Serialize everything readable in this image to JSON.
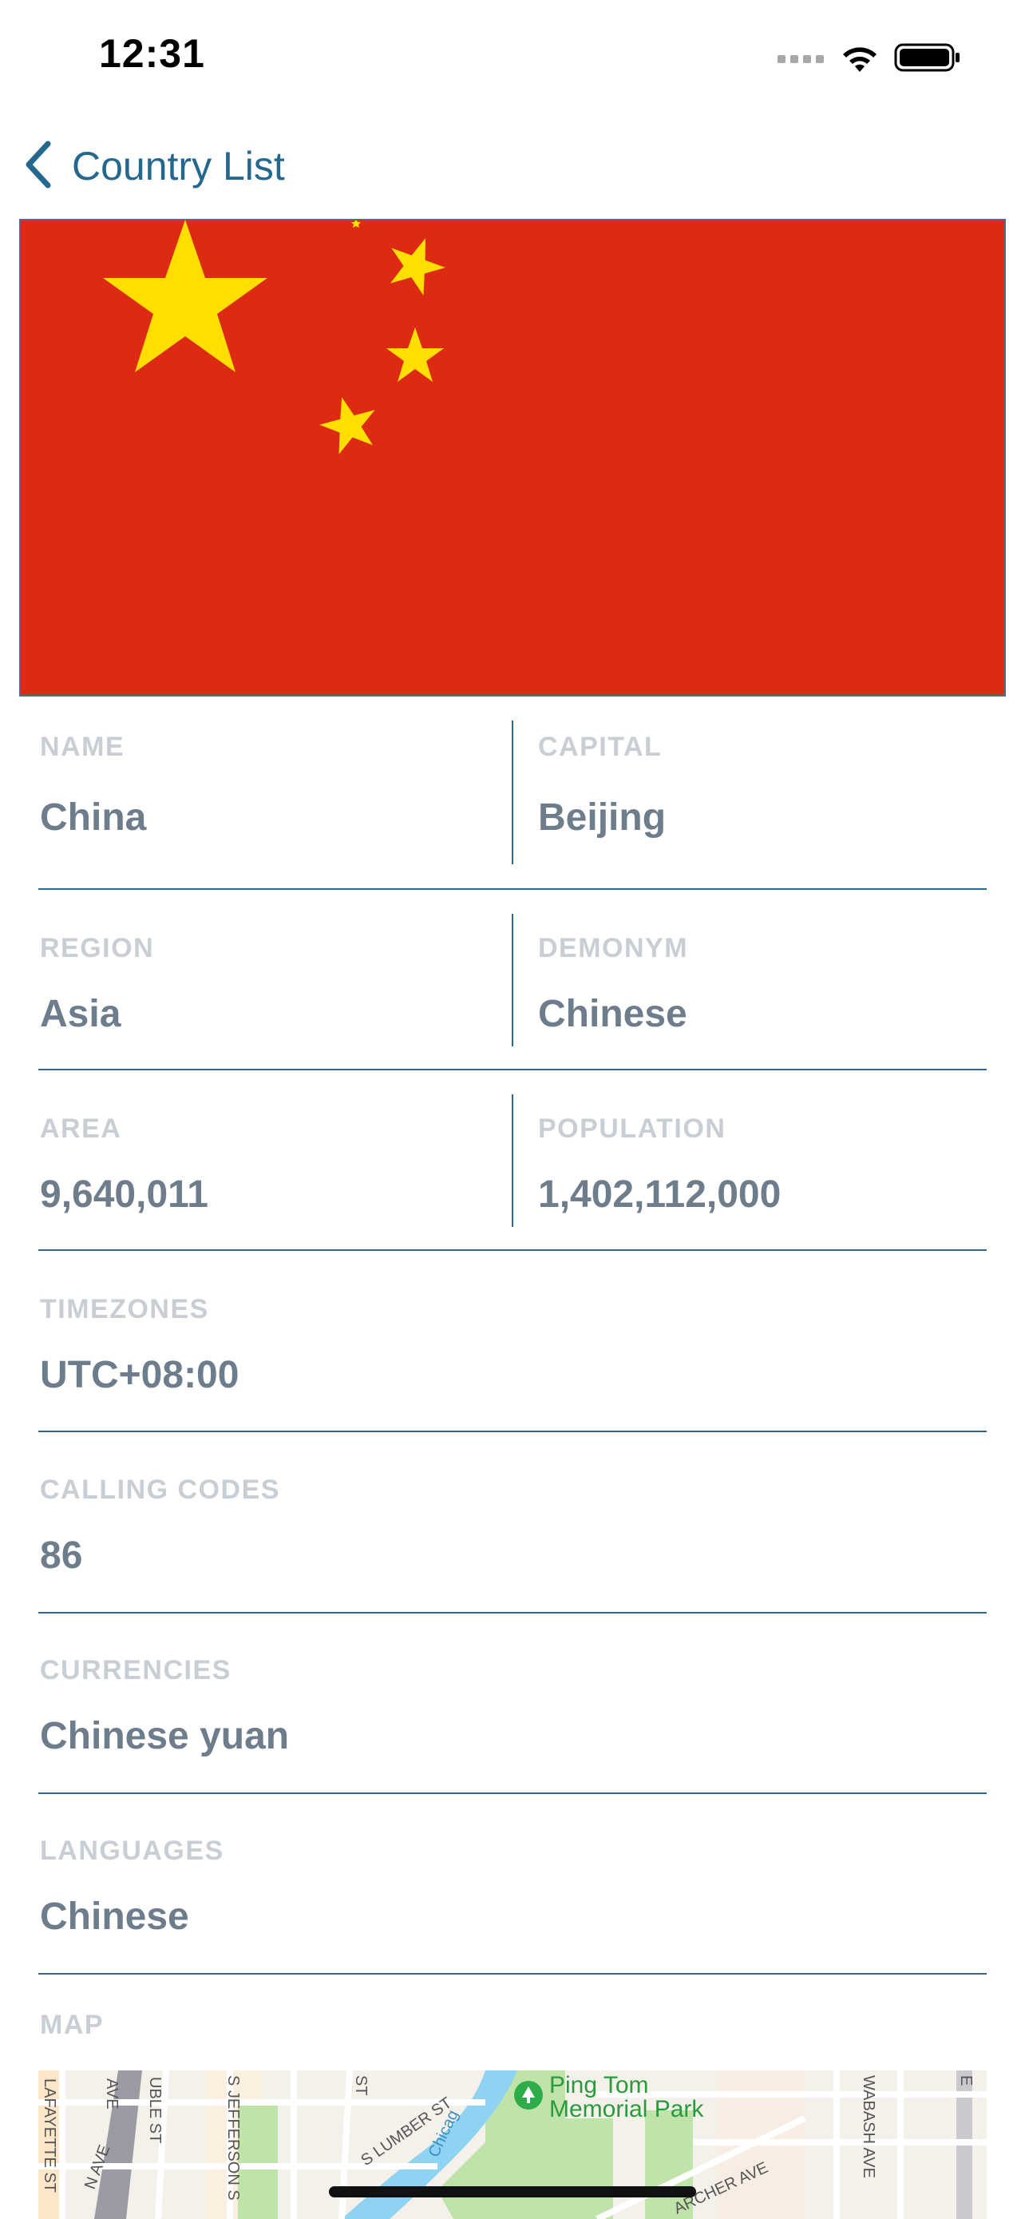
{
  "status_bar": {
    "time": "12:31",
    "icons": [
      "signal-icon",
      "wifi-icon",
      "battery-icon"
    ]
  },
  "nav": {
    "back_label": "Country List",
    "back_icon": "chevron-left-icon"
  },
  "flag": {
    "description_icon": "china-flag-image",
    "colors": {
      "field": "#dd2a12",
      "star": "#ffde00"
    }
  },
  "fields": {
    "name": {
      "label": "NAME",
      "value": "China"
    },
    "capital": {
      "label": "CAPITAL",
      "value": "Beijing"
    },
    "region": {
      "label": "REGION",
      "value": "Asia"
    },
    "demonym": {
      "label": "DEMONYM",
      "value": "Chinese"
    },
    "area": {
      "label": "AREA",
      "value": "9,640,011"
    },
    "population": {
      "label": "POPULATION",
      "value": "1,402,112,000"
    },
    "timezones": {
      "label": "TIMEZONES",
      "value": "UTC+08:00"
    },
    "calling_codes": {
      "label": "CALLING CODES",
      "value": "86"
    },
    "currencies": {
      "label": "CURRENCIES",
      "value": "Chinese yuan"
    },
    "languages": {
      "label": "LANGUAGES",
      "value": "Chinese"
    }
  },
  "map": {
    "label": "MAP",
    "poi_name_line1": "Ping Tom",
    "poi_name_line2": "Memorial Park",
    "street_labels": [
      "AVE",
      "UBLE ST",
      "S JEFFERSON S",
      "ST",
      "S LUMBER ST",
      "Chicag",
      "WABASH AVE",
      "E",
      "N AVE",
      "LAFAYETTE ST",
      "ARCHER AVE"
    ]
  },
  "theme": {
    "accent": "#24678f",
    "label_color": "#c8ced3",
    "value_color": "#6e7d8c",
    "divider": "#2f6a8e"
  }
}
